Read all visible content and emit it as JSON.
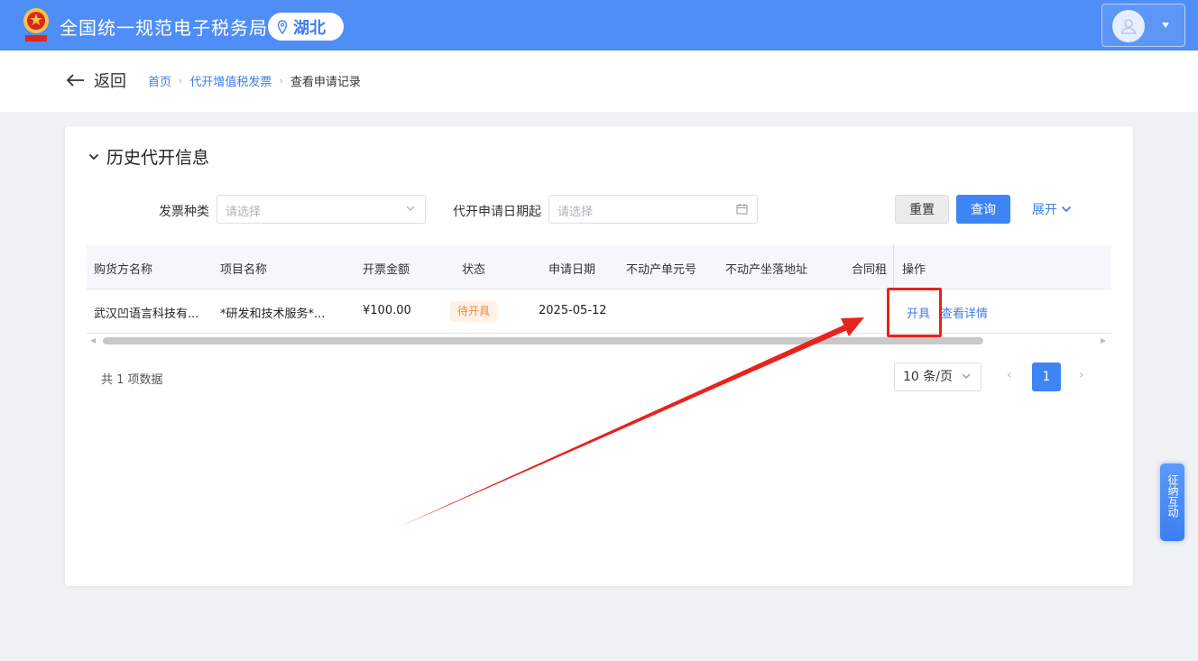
{
  "header": {
    "app_title": "全国统一规范电子税务局",
    "region": "湖北",
    "brand_color": "#4f8ef7",
    "icons": [
      "national-emblem-icon",
      "location-pin-icon",
      "user-avatar-icon",
      "caret-down-icon"
    ]
  },
  "subbar": {
    "back_label": "返回",
    "breadcrumbs": [
      "首页",
      "代开增值税发票",
      "查看申请记录"
    ]
  },
  "card": {
    "title": "历史代开信息",
    "filters": {
      "invoice_type_label": "发票种类",
      "invoice_type_placeholder": "请选择",
      "date_label": "代开申请日期起",
      "date_placeholder": "请选择"
    },
    "buttons": {
      "reset": "重置",
      "query": "查询",
      "expand": "展开"
    },
    "table": {
      "columns": [
        "购货方名称",
        "项目名称",
        "开票金额",
        "状态",
        "申请日期",
        "不动产单元号",
        "不动产坐落地址",
        "合同租",
        "操作"
      ],
      "rows": [
        {
          "buyer": "武汉凹语言科技有...",
          "item": "*研发和技术服务*...",
          "amount": "¥100.00",
          "status": "待开具",
          "date": "2025-05-12",
          "actions": [
            "开具",
            "查看详情"
          ]
        }
      ]
    },
    "pagination": {
      "total_text": "共 1 项数据",
      "page_size": "10 条/页",
      "current_page": "1"
    }
  },
  "float_tab": "征纳互动",
  "annotation_color": "#e8231d"
}
